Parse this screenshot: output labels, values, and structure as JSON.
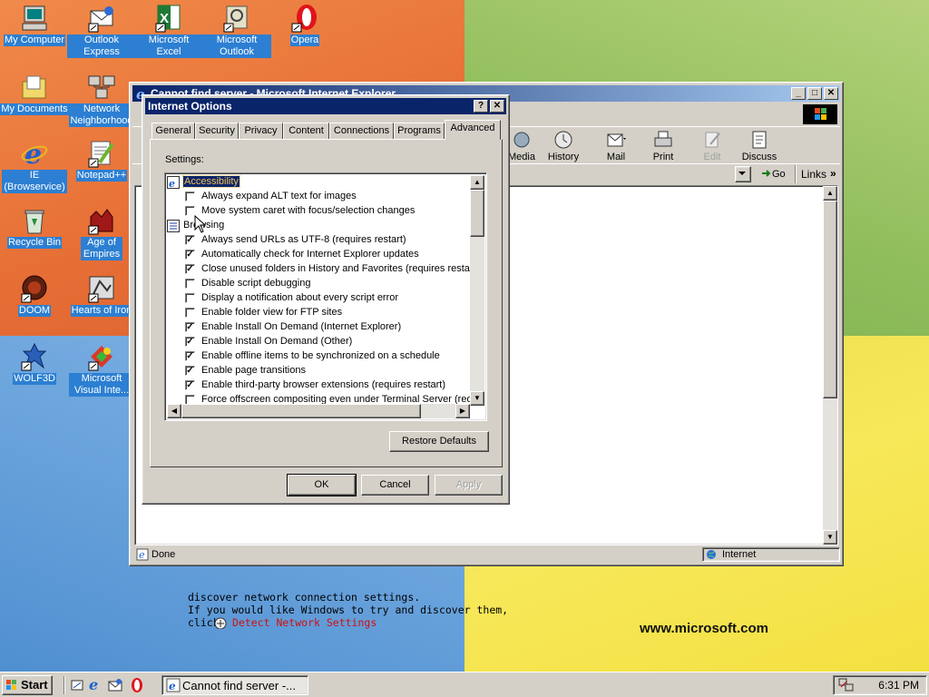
{
  "desktop": {
    "watermark": "www.microsoft.com",
    "icons": [
      {
        "label": "My Computer"
      },
      {
        "label": "Outlook Express"
      },
      {
        "label": "Microsoft Excel"
      },
      {
        "label": "Microsoft Outlook"
      },
      {
        "label": "Opera"
      },
      {
        "label": "My Documents"
      },
      {
        "label": "Network Neighborhood"
      },
      {
        "label": "IE (Browservice)"
      },
      {
        "label": "Notepad++"
      },
      {
        "label": "Recycle Bin"
      },
      {
        "label": "Age of Empires"
      },
      {
        "label": "DOOM"
      },
      {
        "label": "Hearts of Iron"
      },
      {
        "label": "WOLF3D"
      },
      {
        "label": "Microsoft Visual Inte..."
      }
    ]
  },
  "ie_window": {
    "title": "Cannot find server - Microsoft Internet Explorer",
    "toolbar": {
      "media": "Media",
      "history": "History",
      "mail": "Mail",
      "print": "Print",
      "edit": "Edit",
      "discuss": "Discuss"
    },
    "address": {
      "go": "Go",
      "links": "Links"
    },
    "content_lines": [
      "discover network connection settings.",
      "If you would like Windows to try and discover them,",
      "click"
    ],
    "detect_link": "Detect Network Settings",
    "status_text": "Done",
    "zone": "Internet"
  },
  "dialog": {
    "title": "Internet Options",
    "tabs": [
      "General",
      "Security",
      "Privacy",
      "Content",
      "Connections",
      "Programs",
      "Advanced"
    ],
    "active_tab": "Advanced",
    "settings_label": "Settings:",
    "groups": [
      {
        "label": "Accessibility",
        "items": [
          {
            "label": "Always expand ALT text for images",
            "checked": false
          },
          {
            "label": "Move system caret with focus/selection changes",
            "checked": false
          }
        ]
      },
      {
        "label": "Browsing",
        "items": [
          {
            "label": "Always send URLs as UTF-8 (requires restart)",
            "checked": true
          },
          {
            "label": "Automatically check for Internet Explorer updates",
            "checked": true
          },
          {
            "label": "Close unused folders in History and Favorites (requires restart)",
            "checked": true
          },
          {
            "label": "Disable script debugging",
            "checked": false
          },
          {
            "label": "Display a notification about every script error",
            "checked": false
          },
          {
            "label": "Enable folder view for FTP sites",
            "checked": false
          },
          {
            "label": "Enable Install On Demand (Internet Explorer)",
            "checked": true
          },
          {
            "label": "Enable Install On Demand (Other)",
            "checked": true
          },
          {
            "label": "Enable offline items to be synchronized on a schedule",
            "checked": true
          },
          {
            "label": "Enable page transitions",
            "checked": true
          },
          {
            "label": "Enable third-party browser extensions (requires restart)",
            "checked": true
          },
          {
            "label": "Force offscreen compositing even under Terminal Server (requi",
            "checked": false
          }
        ]
      }
    ],
    "restore_defaults": "Restore Defaults",
    "ok": "OK",
    "cancel": "Cancel",
    "apply": "Apply"
  },
  "taskbar": {
    "start": "Start",
    "task_button": "Cannot find server -...",
    "clock": "6:31 PM"
  }
}
